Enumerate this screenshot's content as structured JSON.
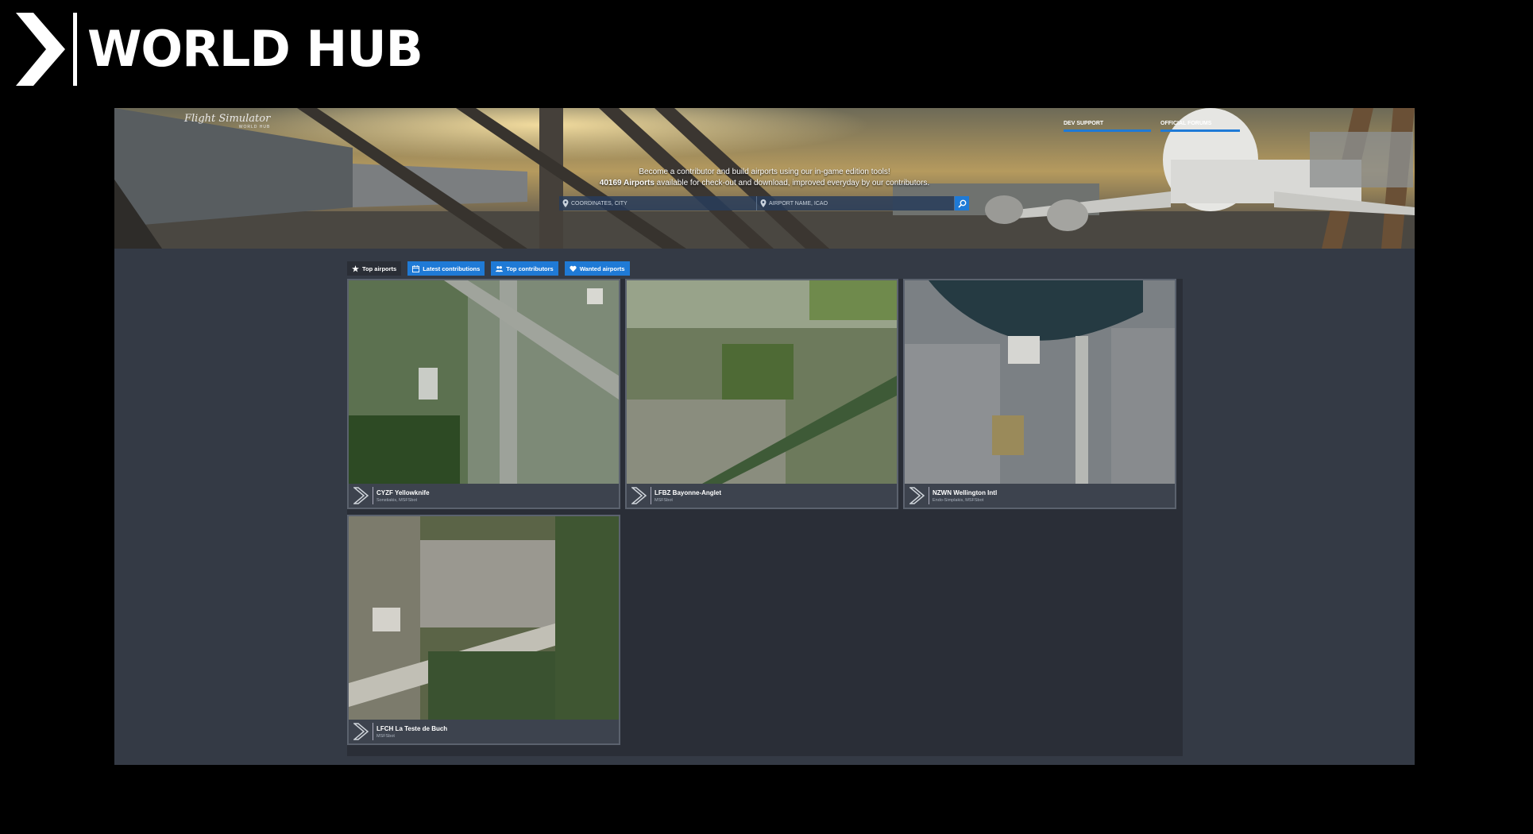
{
  "brand": {
    "title": "WORLD HUB"
  },
  "site": {
    "logo_text": "Flight Simulator",
    "logo_sub": "WORLD HUB",
    "nav": {
      "dev_support": "DEV SUPPORT",
      "official_forums": "OFFICIAL FORUMS"
    },
    "tagline_line1": "Become a contributor and build airports using our in-game edition tools!",
    "airport_count": "40169 Airports",
    "tagline_line2_rest": "available for check-out and download, improved everyday by our contributors.",
    "search": {
      "coords_placeholder": "COORDINATES, CITY",
      "airport_placeholder": "AIRPORT NAME, ICAO"
    },
    "tabs": [
      {
        "label": "Top airports",
        "icon": "star-icon"
      },
      {
        "label": "Latest contributions",
        "icon": "calendar-icon"
      },
      {
        "label": "Top contributors",
        "icon": "users-icon"
      },
      {
        "label": "Wanted airports",
        "icon": "heart-icon"
      }
    ],
    "airports": [
      {
        "title": "CYZF Yellowknife",
        "subtitle": "Sonstiakis, MSFSbot"
      },
      {
        "title": "LFBZ Bayonne-Anglet",
        "subtitle": "MSFSbot"
      },
      {
        "title": "NZWN Wellington Intl",
        "subtitle": "Endo-Simplakis, MSFSbot"
      },
      {
        "title": "LFCH La Teste de Buch",
        "subtitle": "MSFSbot"
      }
    ]
  },
  "colors": {
    "accent": "#1f7ad6",
    "panel": "#2a2e37",
    "page": "#343a45"
  }
}
